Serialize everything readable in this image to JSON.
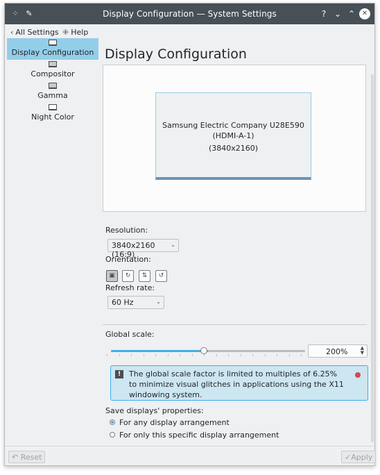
{
  "window": {
    "title": "Display Configuration — System Settings",
    "buttons": {
      "help": "?",
      "minimize": "⌄",
      "maximize": "⌃",
      "close": "✕"
    }
  },
  "toolbar": {
    "all_settings": "All Settings",
    "help": "Help"
  },
  "sidebar": {
    "items": [
      {
        "label": "Display Configuration",
        "active": true
      },
      {
        "label": "Compositor",
        "active": false
      },
      {
        "label": "Gamma",
        "active": false
      },
      {
        "label": "Night Color",
        "active": false
      }
    ]
  },
  "main": {
    "title": "Display Configuration",
    "monitor": {
      "name": "Samsung Electric Company U28E590",
      "port": "(HDMI-A-1)",
      "resolution": "(3840x2160)"
    },
    "resolution_label": "Resolution:",
    "resolution_value": "3840x2160 (16:9)",
    "orientation_label": "Orientation:",
    "refresh_label": "Refresh rate:",
    "refresh_value": "60 Hz",
    "global_scale_label": "Global scale:",
    "global_scale_value": "200%",
    "global_scale_fraction": 0.5,
    "message": "The global scale factor is limited to multiples of 6.25% to minimize visual glitches in applications using the X11 windowing system.",
    "save_label": "Save displays' properties:",
    "save_options": [
      {
        "label": "For any display arrangement",
        "selected": true
      },
      {
        "label": "For only this specific display arrangement",
        "selected": false
      }
    ]
  },
  "footer": {
    "reset": "Reset",
    "apply": "Apply"
  },
  "colors": {
    "titlebar": "#475057",
    "selection": "#93cee9",
    "accent": "#3daee9",
    "message_bg": "#cce6f2"
  }
}
